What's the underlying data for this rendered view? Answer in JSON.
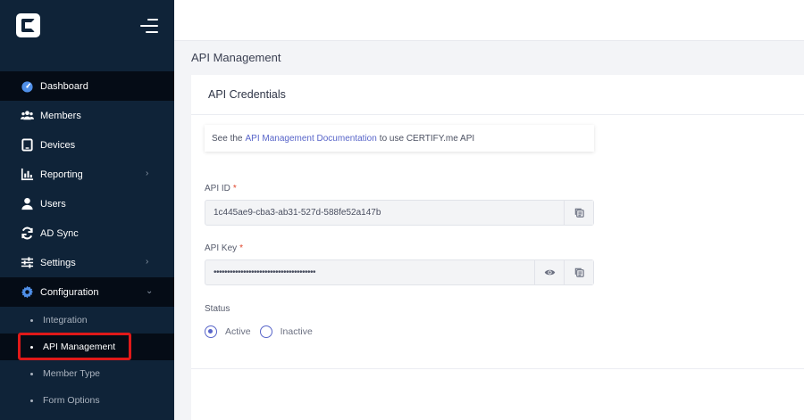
{
  "sidebar": {
    "items": [
      {
        "label": "Dashboard",
        "icon": "dashboard-icon",
        "active": true
      },
      {
        "label": "Members",
        "icon": "members-icon"
      },
      {
        "label": "Devices",
        "icon": "devices-icon"
      },
      {
        "label": "Reporting",
        "icon": "reporting-icon",
        "chevron": "›"
      },
      {
        "label": "Users",
        "icon": "user-icon"
      },
      {
        "label": "AD Sync",
        "icon": "sync-icon"
      },
      {
        "label": "Settings",
        "icon": "sliders-icon",
        "chevron": "›"
      },
      {
        "label": "Configuration",
        "icon": "gear-icon",
        "chevron": "⌄"
      }
    ],
    "sub_items": [
      {
        "label": "Integration"
      },
      {
        "label": "API Management",
        "active": true
      },
      {
        "label": "Member Type"
      },
      {
        "label": "Form Options"
      }
    ]
  },
  "page": {
    "title": "API Management"
  },
  "card": {
    "header": "API Credentials",
    "info": {
      "prefix": "See the",
      "link": "API Management Documentation",
      "suffix": "to use CERTIFY.me API"
    },
    "api_id": {
      "label": "API ID",
      "required": "*",
      "value": "1c445ae9-cba3-ab31-527d-588fe52a147b"
    },
    "api_key": {
      "label": "API Key",
      "required": "*",
      "value": "••••••••••••••••••••••••••••••••••••••"
    },
    "status": {
      "label": "Status",
      "options": [
        {
          "label": "Active",
          "checked": true
        },
        {
          "label": "Inactive",
          "checked": false
        }
      ]
    }
  },
  "colors": {
    "sidebar_bg": "#0f2338",
    "active_bg": "#050c16",
    "accent": "#5865c9",
    "highlight": "#e01919"
  }
}
